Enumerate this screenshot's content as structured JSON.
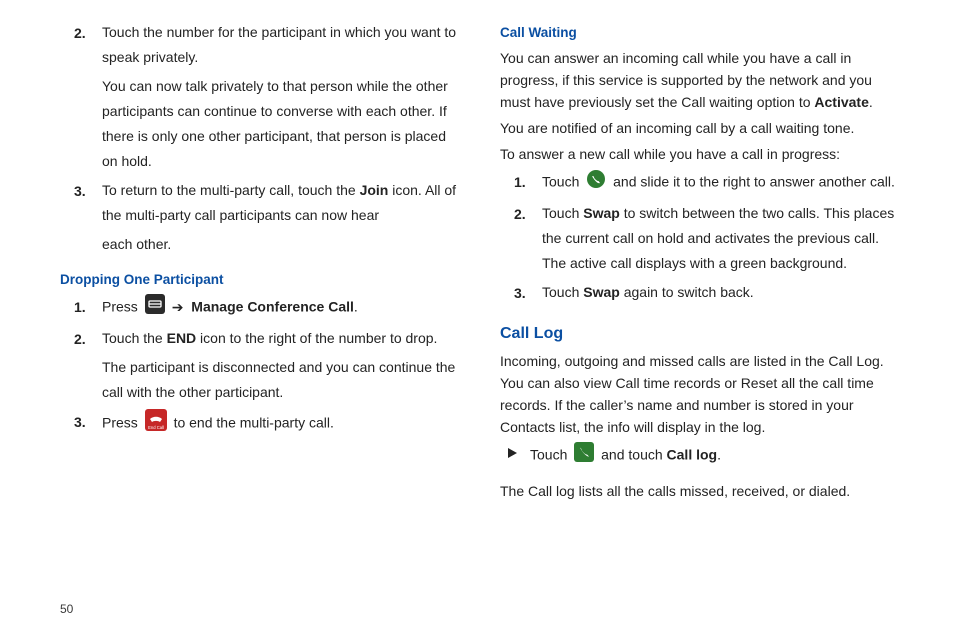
{
  "page_number": "50",
  "left": {
    "steps_a": {
      "item2": {
        "num": "2.",
        "p1": "Touch the number for the participant in which you want to speak privately.",
        "p2": "You can now talk privately to that person while the other participants can continue to converse with each other. If there is only one other participant, that person is placed on hold."
      },
      "item3": {
        "num": "3.",
        "p1a": "To return to the multi-party call, touch the ",
        "join": "Join",
        "p1b": " icon. All of the multi-party call participants can now hear",
        "p2": "each other."
      }
    },
    "subhead": "Dropping One Participant",
    "steps_b": {
      "item1": {
        "num": "1.",
        "p_a": "Press ",
        "p_b": " Manage Conference Call",
        "p_c": "."
      },
      "item2": {
        "num": "2.",
        "p1a": "Touch the ",
        "end": "END",
        "p1b": " icon to the right of the number to drop.",
        "p2": "The participant is disconnected and you can continue the call with the other participant."
      },
      "item3": {
        "num": "3.",
        "p_a": "Press ",
        "p_b": " to end the multi-party call."
      }
    }
  },
  "right": {
    "subhead": "Call Waiting",
    "p1a": "You can answer an incoming call while you have a call in progress, if this service is supported by the network and you must have previously set the Call waiting option to ",
    "activate": "Activate",
    "p1b": ".",
    "p2": "You are notified of an incoming call by a call waiting tone.",
    "p3": "To answer a new call while you have a call in progress:",
    "steps": {
      "item1": {
        "num": "1.",
        "p_a": "Touch ",
        "p_b": " and slide it to the right to answer another call."
      },
      "item2": {
        "num": "2.",
        "p_a": "Touch ",
        "swap": "Swap",
        "p_b": " to switch between the two calls. This places the current call on hold and activates the previous call. The active call displays with a green background."
      },
      "item3": {
        "num": "3.",
        "p_a": "Touch ",
        "swap": "Swap",
        "p_b": " again to switch back."
      }
    },
    "section_head": "Call Log",
    "p4": "Incoming, outgoing and missed calls are listed in the Call Log. You can also view Call time records or Reset all the call time records. If the caller’s name and number is stored in your Contacts list, the info will display in the log.",
    "bullet": {
      "p_a": "Touch ",
      "p_b": " and touch ",
      "call_log": "Call log",
      "p_c": "."
    },
    "p5": "The Call log lists all the calls missed, received, or dialed."
  }
}
